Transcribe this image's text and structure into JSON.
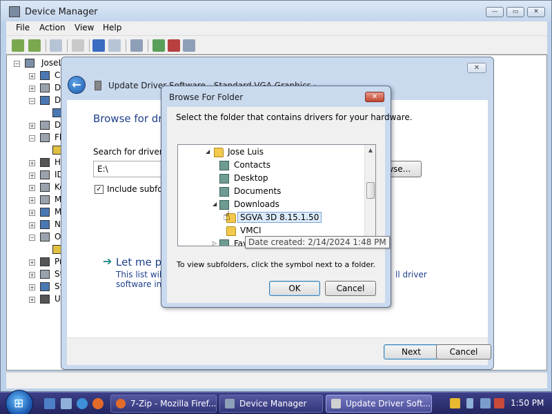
{
  "device_manager": {
    "title": "Device Manager",
    "menu": [
      "File",
      "Action",
      "View",
      "Help"
    ],
    "tree": {
      "root": "JoseL",
      "items": [
        "Co",
        "Di",
        "Di",
        "DV",
        "Fl",
        "Hu",
        "ID",
        "Ke",
        "Mi",
        "Mo",
        "Ne",
        "Ot",
        "Pr",
        "St",
        "Sy",
        "Un"
      ]
    }
  },
  "update_driver": {
    "title": "Update Driver Software - Standard VGA Graphics Adapter",
    "heading": "Browse for dri",
    "search_label": "Search for driver so",
    "path_value": "E:\\",
    "browse_label": "owse...",
    "include_subfolders_label": "Include subfold",
    "include_subfolders_checked": true,
    "pick_title": "Let me pi",
    "pick_desc_line1": "This list wil",
    "pick_desc_line2": "software in t",
    "pick_desc_right": "ll driver",
    "next_label": "Next",
    "cancel_label": "Cancel"
  },
  "browse_folder": {
    "title": "Browse For Folder",
    "close_glyph": "✕",
    "description": "Select the folder that contains drivers for your hardware.",
    "tree": [
      {
        "label": "Jose Luis",
        "expander": "◢",
        "icon": "folder"
      },
      {
        "label": "Contacts",
        "expander": "",
        "icon": "special"
      },
      {
        "label": "Desktop",
        "expander": "",
        "icon": "special"
      },
      {
        "label": "Documents",
        "expander": "",
        "icon": "special"
      },
      {
        "label": "Downloads",
        "expander": "◢",
        "icon": "special"
      },
      {
        "label": "SGVA 3D 8.15.1.50",
        "expander": "",
        "icon": "folder",
        "selected": true
      },
      {
        "label": "VMCI",
        "expander": "",
        "icon": "folder"
      },
      {
        "label": "Fav",
        "expander": "▷",
        "icon": "special"
      }
    ],
    "tooltip": "Date created: 2/14/2024 1:48 PM",
    "hint": "To view subfolders, click the symbol next to a folder.",
    "ok_label": "OK",
    "cancel_label": "Cancel"
  },
  "taskbar": {
    "tasks": [
      "7-Zip - Mozilla Firef...",
      "Device Manager",
      "Update Driver Soft..."
    ],
    "clock": "1:50 PM"
  },
  "colors": {
    "accent_blue": "#1e3e8a",
    "taskbar": "#2e3070",
    "close_red": "#c2452f"
  }
}
